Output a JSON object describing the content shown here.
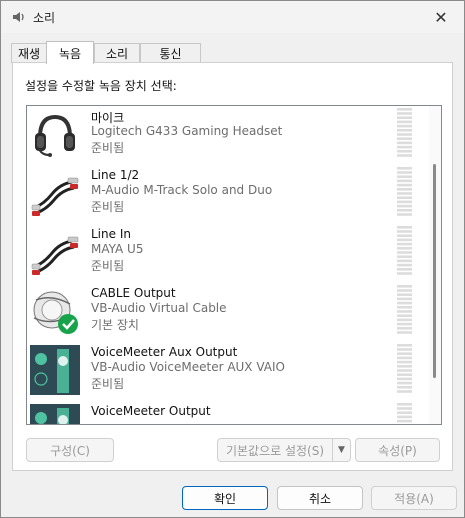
{
  "window": {
    "title": "소리",
    "close_glyph": "✕"
  },
  "tabs": [
    {
      "label": "재생",
      "active": false
    },
    {
      "label": "녹음",
      "active": true
    },
    {
      "label": "소리",
      "active": false
    },
    {
      "label": "통신",
      "active": false
    }
  ],
  "instruction": "설정을 수정할 녹음 장치 선택:",
  "devices": [
    {
      "name": "마이크",
      "description": "Logitech G433 Gaming Headset",
      "status": "준비됨",
      "icon": "headset-icon"
    },
    {
      "name": "Line 1/2",
      "description": "M-Audio M-Track Solo and Duo",
      "status": "준비됨",
      "icon": "rca-cable-icon"
    },
    {
      "name": "Line In",
      "description": "MAYA U5",
      "status": "준비됨",
      "icon": "rca-cable-icon"
    },
    {
      "name": "CABLE Output",
      "description": "VB-Audio Virtual Cable",
      "status": "기본 장치",
      "icon": "virtual-cable-default-icon"
    },
    {
      "name": "VoiceMeeter Aux Output",
      "description": "VB-Audio VoiceMeeter AUX VAIO",
      "status": "준비됨",
      "icon": "voicemeeter-icon"
    },
    {
      "name": "VoiceMeeter Output",
      "description": "",
      "status": "",
      "icon": "voicemeeter-icon"
    }
  ],
  "buttons": {
    "configure": "구성(C)",
    "set_default": "기본값으로 설정(S)",
    "properties": "속성(P)",
    "ok": "확인",
    "cancel": "취소",
    "apply": "적용(A)"
  },
  "colors": {
    "accent": "#0067c0",
    "default_check": "#16a34a",
    "meter": "#dcdcdc"
  }
}
